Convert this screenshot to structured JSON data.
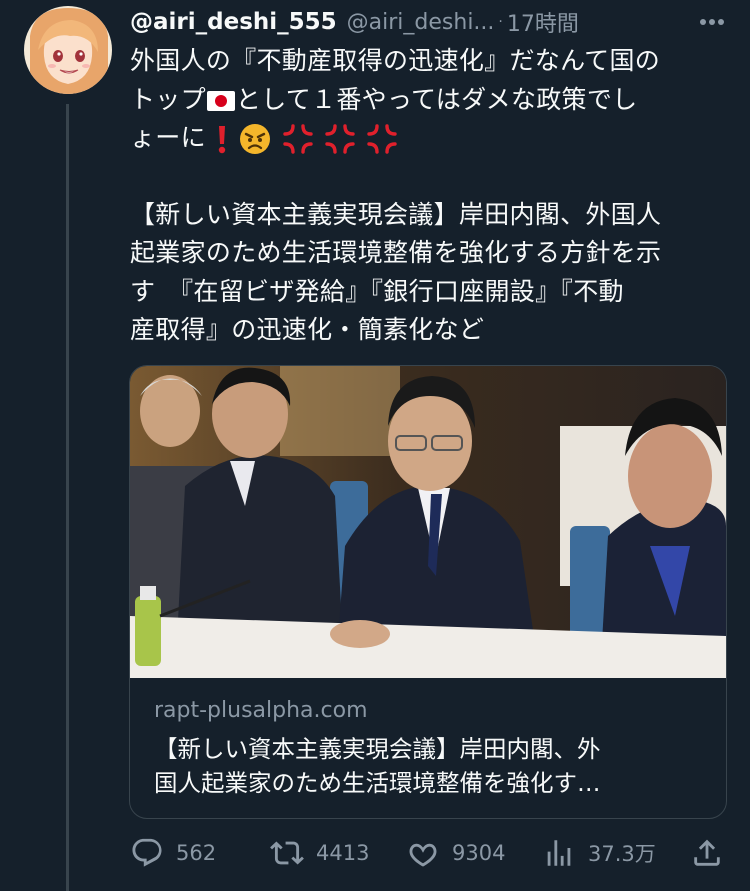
{
  "author": {
    "display_name": "@airi_deshi_555",
    "handle": "@airi_deshi...",
    "separator": "·",
    "time": "17時間"
  },
  "tweet": {
    "line1": "外国人の『不動産取得の迅速化』だなんて国の",
    "line2_a": "トップ",
    "line2_b": "として１番やってはダメな政策でし",
    "line3": "ょーに",
    "p2_line1": "【新しい資本主義実現会議】岸田内閣、外国人",
    "p2_line2": "起業家のため生活環境整備を強化する方針を示",
    "p2_line3": "す　『在留ビザ発給』『銀行口座開設』『不動",
    "p2_line4": "産取得』の迅速化・簡素化など"
  },
  "card": {
    "domain": "rapt-plusalpha.com",
    "title_line1": "【新しい資本主義実現会議】岸田内閣、外",
    "title_line2": "国人起業家のため生活環境整備を強化す…"
  },
  "actions": {
    "replies": "562",
    "retweets": "4413",
    "likes": "9304",
    "views": "37.3万"
  },
  "colors": {
    "background": "#15202b",
    "text_primary": "#f7f9f9",
    "text_secondary": "#8b98a5",
    "border": "#38444d"
  },
  "icons": [
    "more-icon",
    "japan-flag-icon",
    "exclamation-icon",
    "angry-face-icon",
    "anger-symbol-icon",
    "reply-icon",
    "retweet-icon",
    "like-icon",
    "views-icon",
    "share-icon"
  ]
}
